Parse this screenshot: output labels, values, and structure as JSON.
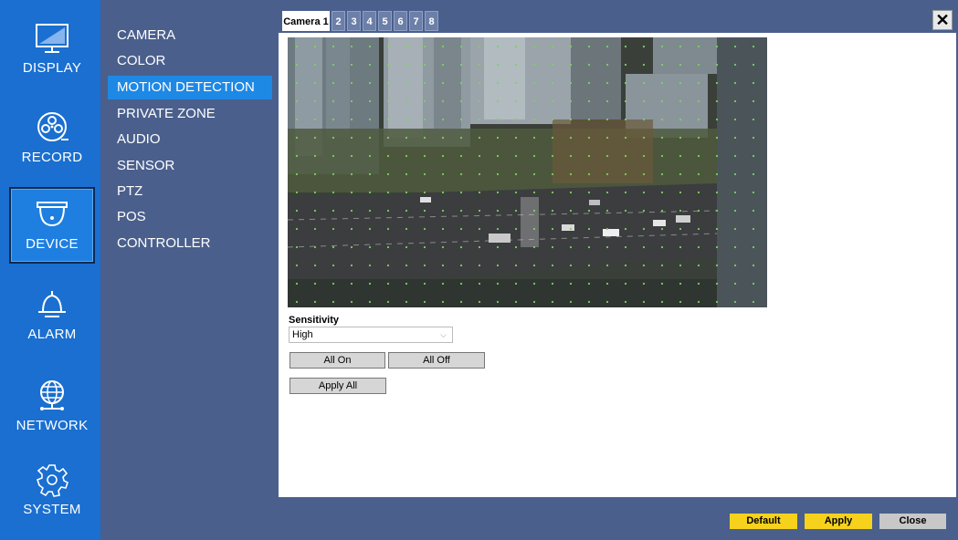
{
  "rail": {
    "items": [
      {
        "label": "DISPLAY",
        "icon": "monitor-icon"
      },
      {
        "label": "RECORD",
        "icon": "film-reel-icon"
      },
      {
        "label": "DEVICE",
        "icon": "dome-camera-icon"
      },
      {
        "label": "ALARM",
        "icon": "bell-icon"
      },
      {
        "label": "NETWORK",
        "icon": "globe-network-icon"
      },
      {
        "label": "SYSTEM",
        "icon": "gear-icon"
      }
    ],
    "active": "DEVICE"
  },
  "submenu": {
    "items": [
      "CAMERA",
      "COLOR",
      "MOTION DETECTION",
      "PRIVATE ZONE",
      "AUDIO",
      "SENSOR",
      "PTZ",
      "POS",
      "CONTROLLER"
    ],
    "active": "MOTION DETECTION"
  },
  "tabs": [
    "Camera 1",
    "2",
    "3",
    "4",
    "5",
    "6",
    "7",
    "8"
  ],
  "close_glyph": "✕",
  "sensitivity": {
    "label": "Sensitivity",
    "value": "High"
  },
  "buttons": {
    "all_on": "All On",
    "all_off": "All Off",
    "apply_all": "Apply All"
  },
  "footer": {
    "default": "Default",
    "apply": "Apply",
    "close": "Close"
  },
  "colors": {
    "rail": "#1a6fd0",
    "sidebar": "#4a5f8c",
    "accent": "#1e88e5",
    "yellow_button": "#f6d21d"
  }
}
